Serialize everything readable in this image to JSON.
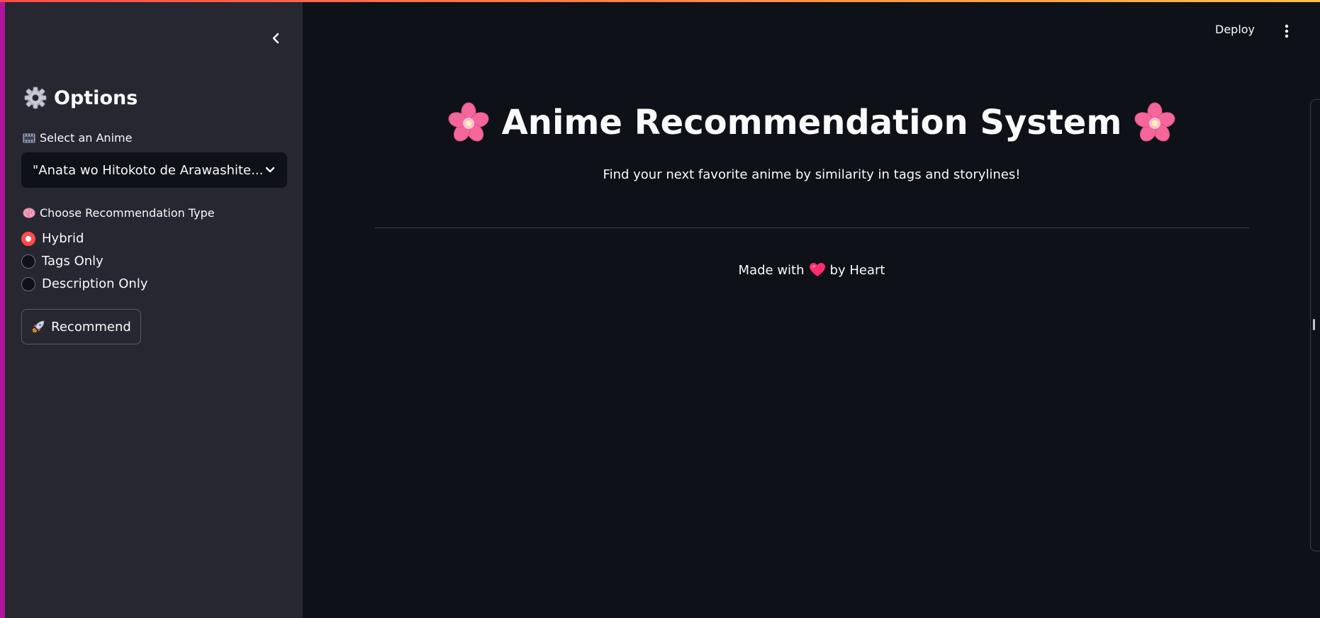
{
  "sidebar": {
    "collapse_icon": "chevron-left-icon",
    "title_icon": "gear-icon",
    "title": "Options",
    "anime_select": {
      "label_icon": "film-frames-icon",
      "label": "Select an Anime",
      "value": "\"Anata wo Hitokoto de Arawashite...",
      "icon": "chevron-down-icon"
    },
    "recommendation_type": {
      "label_icon": "brain-icon",
      "label": "Choose Recommendation Type",
      "options": [
        {
          "label": "Hybrid",
          "checked": true
        },
        {
          "label": "Tags Only",
          "checked": false
        },
        {
          "label": "Description Only",
          "checked": false
        }
      ]
    },
    "recommend_button": {
      "icon": "rocket-icon",
      "label": "Recommend"
    }
  },
  "header": {
    "deploy_label": "Deploy",
    "menu_icon": "vertical-dots-icon"
  },
  "main": {
    "title": "Anime Recommendation System",
    "title_icons": [
      "cherry-blossom-icon",
      "cherry-blossom-icon"
    ],
    "subtitle": "Find your next favorite anime by similarity in tags and storylines!",
    "footer": {
      "before": "Made with",
      "icon": "heart-icon",
      "after": "by Heart"
    }
  },
  "colors": {
    "accent": "#ff4b4b",
    "background": "#0e1117",
    "sidebar": "#262730",
    "left_edge": "#b0159b",
    "flower_pink": "#f5679b",
    "heart": "#ff2d6f"
  }
}
